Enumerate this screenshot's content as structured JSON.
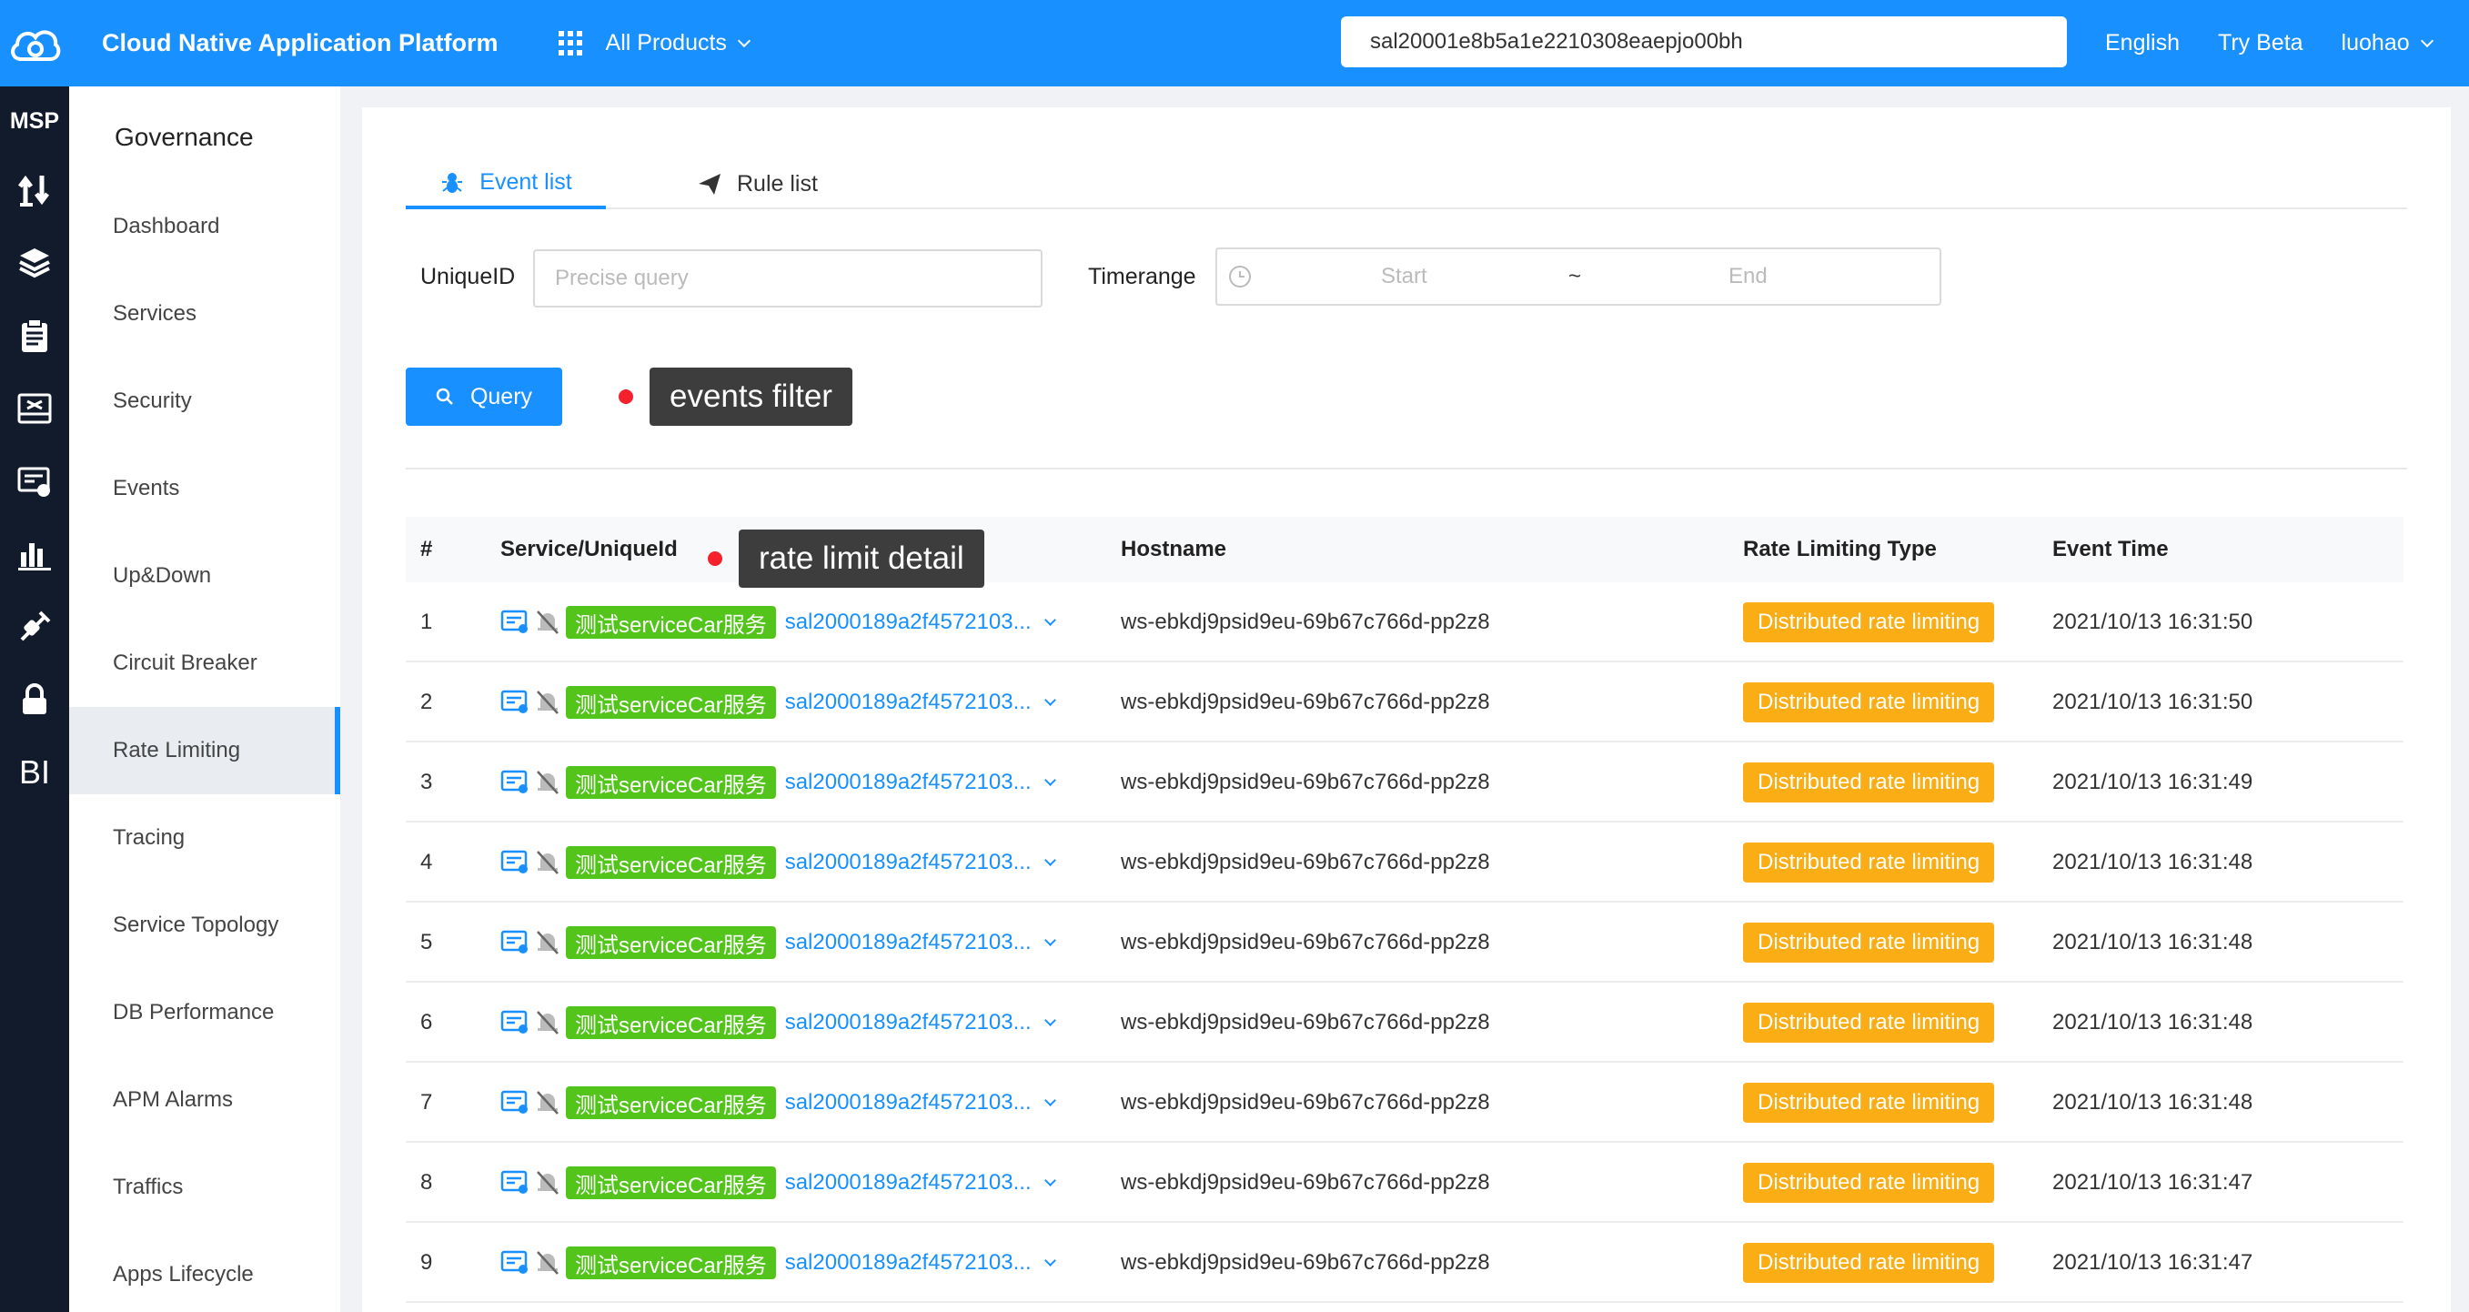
{
  "header": {
    "title": "Cloud Native Application Platform",
    "products_label": "All Products",
    "search_value": "sal20001e8b5a1e2210308eaepjo00bh",
    "language": "English",
    "try_beta": "Try Beta",
    "user": "luohao"
  },
  "rail": {
    "label": "MSP",
    "icons": [
      "transfer-icon",
      "layers-icon",
      "clipboard-icon",
      "monitor-icon",
      "billing-icon",
      "bar-chart-icon",
      "plug-icon",
      "lock-icon",
      "bi-icon"
    ],
    "bi_label": "BI"
  },
  "nav": {
    "title": "Governance",
    "items": [
      "Dashboard",
      "Services",
      "Security",
      "Events",
      "Up&Down",
      "Circuit Breaker",
      "Rate Limiting",
      "Tracing",
      "Service Topology",
      "DB Performance",
      "APM Alarms",
      "Traffics",
      "Apps Lifecycle"
    ],
    "active": "Rate Limiting"
  },
  "tabs": [
    {
      "label": "Event list",
      "icon": "bug-icon",
      "active": true
    },
    {
      "label": "Rule list",
      "icon": "send-icon",
      "active": false
    }
  ],
  "filters": {
    "uniqueid_label": "UniqueID",
    "uniqueid_placeholder": "Precise query",
    "timerange_label": "Timerange",
    "start_placeholder": "Start",
    "separator": "~",
    "end_placeholder": "End",
    "query_label": "Query"
  },
  "annotations": {
    "events_filter": "events filter",
    "rate_limit_detail": "rate limit detail"
  },
  "table": {
    "columns": [
      "#",
      "Service/UniqueId",
      "Hostname",
      "Rate Limiting Type",
      "Event Time"
    ],
    "rows": [
      {
        "n": "1",
        "service": "测试serviceCar服务",
        "uid": "sal2000189a2f4572103...",
        "host": "ws-ebkdj9psid9eu-69b67c766d-pp2z8",
        "type": "Distributed rate limiting",
        "time": "2021/10/13 16:31:50"
      },
      {
        "n": "2",
        "service": "测试serviceCar服务",
        "uid": "sal2000189a2f4572103...",
        "host": "ws-ebkdj9psid9eu-69b67c766d-pp2z8",
        "type": "Distributed rate limiting",
        "time": "2021/10/13 16:31:50"
      },
      {
        "n": "3",
        "service": "测试serviceCar服务",
        "uid": "sal2000189a2f4572103...",
        "host": "ws-ebkdj9psid9eu-69b67c766d-pp2z8",
        "type": "Distributed rate limiting",
        "time": "2021/10/13 16:31:49"
      },
      {
        "n": "4",
        "service": "测试serviceCar服务",
        "uid": "sal2000189a2f4572103...",
        "host": "ws-ebkdj9psid9eu-69b67c766d-pp2z8",
        "type": "Distributed rate limiting",
        "time": "2021/10/13 16:31:48"
      },
      {
        "n": "5",
        "service": "测试serviceCar服务",
        "uid": "sal2000189a2f4572103...",
        "host": "ws-ebkdj9psid9eu-69b67c766d-pp2z8",
        "type": "Distributed rate limiting",
        "time": "2021/10/13 16:31:48"
      },
      {
        "n": "6",
        "service": "测试serviceCar服务",
        "uid": "sal2000189a2f4572103...",
        "host": "ws-ebkdj9psid9eu-69b67c766d-pp2z8",
        "type": "Distributed rate limiting",
        "time": "2021/10/13 16:31:48"
      },
      {
        "n": "7",
        "service": "测试serviceCar服务",
        "uid": "sal2000189a2f4572103...",
        "host": "ws-ebkdj9psid9eu-69b67c766d-pp2z8",
        "type": "Distributed rate limiting",
        "time": "2021/10/13 16:31:48"
      },
      {
        "n": "8",
        "service": "测试serviceCar服务",
        "uid": "sal2000189a2f4572103...",
        "host": "ws-ebkdj9psid9eu-69b67c766d-pp2z8",
        "type": "Distributed rate limiting",
        "time": "2021/10/13 16:31:47"
      },
      {
        "n": "9",
        "service": "测试serviceCar服务",
        "uid": "sal2000189a2f4572103...",
        "host": "ws-ebkdj9psid9eu-69b67c766d-pp2z8",
        "type": "Distributed rate limiting",
        "time": "2021/10/13 16:31:47"
      }
    ]
  },
  "colors": {
    "primary": "#1890ff",
    "rail": "#111b2b",
    "service_tag": "#52c41a",
    "rate_tag": "#faad14",
    "annotation_dot": "#f5222d"
  }
}
